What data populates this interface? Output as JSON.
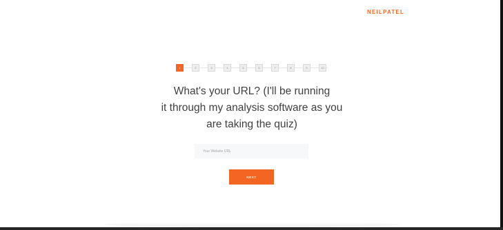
{
  "header": {
    "brand": "NEILPATEL"
  },
  "progress": {
    "current": 1,
    "steps": [
      "1",
      "2",
      "3",
      "4",
      "5",
      "6",
      "7",
      "8",
      "9",
      "10"
    ]
  },
  "quiz": {
    "question_line1": "What's your URL? (I'll be running",
    "question_line2": "it through my analysis software as you",
    "question_line3": "are taking the quiz)"
  },
  "form": {
    "url_placeholder": "Your Website URL",
    "url_value": "",
    "next_label": "NEXT"
  },
  "colors": {
    "accent": "#f26522",
    "text": "#3f3f3f",
    "input_bg": "#f7f8fa"
  }
}
